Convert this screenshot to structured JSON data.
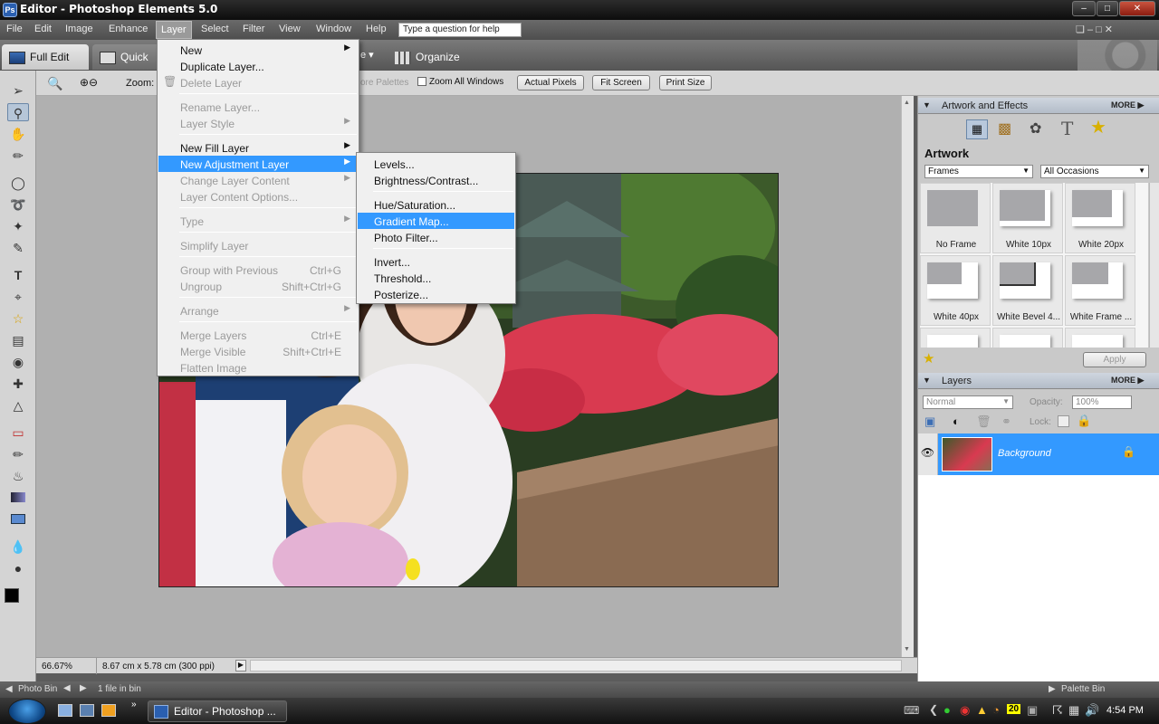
{
  "window": {
    "title": "Editor - Photoshop Elements 5.0",
    "app_icon_label": "Ps"
  },
  "menubar": {
    "items": [
      "File",
      "Edit",
      "Image",
      "Enhance",
      "Layer",
      "Select",
      "Filter",
      "View",
      "Window",
      "Help"
    ],
    "help_placeholder": "Type a question for help"
  },
  "modebar": {
    "full_edit": "Full Edit",
    "quick": "Quick",
    "organize": "Organize"
  },
  "options": {
    "zoom_label": "Zoom:",
    "more_palettes": "ore Palettes",
    "zoom_all_windows": "Zoom All Windows",
    "actual_pixels": "Actual Pixels",
    "fit_screen": "Fit Screen",
    "print_size": "Print Size"
  },
  "layer_menu": [
    {
      "label": "New",
      "submenu": true
    },
    {
      "label": "Duplicate Layer..."
    },
    {
      "label": "Delete Layer",
      "disabled": true
    },
    {
      "label": "Rename Layer...",
      "disabled": true
    },
    {
      "label": "Layer Style",
      "disabled": true,
      "submenu": true
    },
    {
      "label": "New Fill Layer",
      "submenu": true
    },
    {
      "label": "New Adjustment Layer",
      "submenu": true,
      "highlighted": true
    },
    {
      "label": "Change Layer Content",
      "disabled": true,
      "submenu": true
    },
    {
      "label": "Layer Content Options...",
      "disabled": true
    },
    {
      "label": "Type",
      "disabled": true,
      "submenu": true
    },
    {
      "label": "Simplify Layer",
      "disabled": true
    },
    {
      "label": "Group with Previous",
      "disabled": true,
      "shortcut": "Ctrl+G"
    },
    {
      "label": "Ungroup",
      "disabled": true,
      "shortcut": "Shift+Ctrl+G"
    },
    {
      "label": "Arrange",
      "disabled": true,
      "submenu": true
    },
    {
      "label": "Merge Layers",
      "disabled": true,
      "shortcut": "Ctrl+E"
    },
    {
      "label": "Merge Visible",
      "disabled": true,
      "shortcut": "Shift+Ctrl+E"
    },
    {
      "label": "Flatten Image",
      "disabled": true
    }
  ],
  "adjustment_submenu": [
    {
      "label": "Levels..."
    },
    {
      "label": "Brightness/Contrast..."
    },
    {
      "label": "Hue/Saturation..."
    },
    {
      "label": "Gradient Map...",
      "highlighted": true
    },
    {
      "label": "Photo Filter..."
    },
    {
      "label": "Invert..."
    },
    {
      "label": "Threshold..."
    },
    {
      "label": "Posterize..."
    }
  ],
  "status": {
    "zoom": "66.67%",
    "doc_size": "8.67 cm x 5.78 cm (300 ppi)"
  },
  "photobin": {
    "label": "Photo Bin",
    "count": "1 file in bin",
    "palette_bin": "Palette Bin"
  },
  "artwork_panel": {
    "header": "Artwork and Effects",
    "more": "MORE",
    "title": "Artwork",
    "category": "Frames",
    "occasion": "All Occasions",
    "apply": "Apply",
    "thumbs": [
      "No Frame",
      "White 10px",
      "White 20px",
      "White 40px",
      "White Bevel 4...",
      "White Frame ..."
    ]
  },
  "layers_panel": {
    "header": "Layers",
    "more": "MORE",
    "blend_mode": "Normal",
    "opacity_label": "Opacity:",
    "opacity": "100%",
    "lock_label": "Lock:",
    "layer_name": "Background"
  },
  "taskbar": {
    "task": "Editor - Photoshop ...",
    "clock": "4:54 PM",
    "tray_number": "20"
  }
}
